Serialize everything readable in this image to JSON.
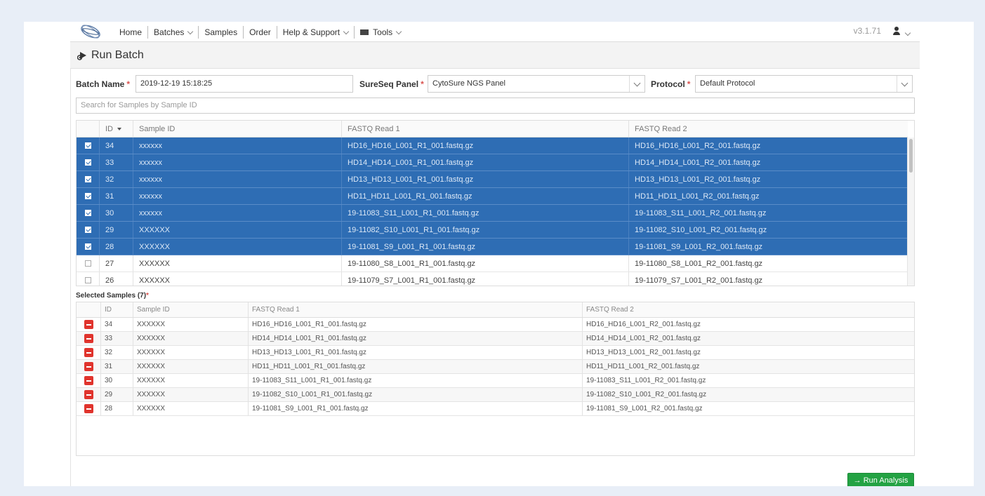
{
  "navbar": {
    "items": [
      {
        "label": "Home",
        "dropdown": false
      },
      {
        "label": "Batches",
        "dropdown": true
      },
      {
        "label": "Samples",
        "dropdown": false
      },
      {
        "label": "Order",
        "dropdown": false
      },
      {
        "label": "Help & Support",
        "dropdown": true
      },
      {
        "label": "Tools",
        "dropdown": true,
        "icon": "toolbox-icon"
      }
    ],
    "version": "v3.1.71"
  },
  "page": {
    "title": "Run Batch"
  },
  "form": {
    "batch_name_label": "Batch Name",
    "batch_name_value": "2019-12-19 15:18:25",
    "panel_label": "SureSeq Panel",
    "panel_value": "CytoSure NGS Panel",
    "protocol_label": "Protocol",
    "protocol_value": "Default Protocol",
    "required_mark": "*"
  },
  "search": {
    "placeholder": "Search for Samples by Sample ID"
  },
  "samples_table": {
    "columns": [
      "ID",
      "Sample ID",
      "FASTQ Read 1",
      "FASTQ Read 2"
    ],
    "rows": [
      {
        "id": "34",
        "sample_id": "xxxxxx",
        "read1": "HD16_HD16_L001_R1_001.fastq.gz",
        "read2": "HD16_HD16_L001_R2_001.fastq.gz",
        "selected": true
      },
      {
        "id": "33",
        "sample_id": "xxxxxx",
        "read1": "HD14_HD14_L001_R1_001.fastq.gz",
        "read2": "HD14_HD14_L001_R2_001.fastq.gz",
        "selected": true
      },
      {
        "id": "32",
        "sample_id": "xxxxxx",
        "read1": "HD13_HD13_L001_R1_001.fastq.gz",
        "read2": "HD13_HD13_L001_R2_001.fastq.gz",
        "selected": true
      },
      {
        "id": "31",
        "sample_id": "xxxxxx",
        "read1": "HD11_HD11_L001_R1_001.fastq.gz",
        "read2": "HD11_HD11_L001_R2_001.fastq.gz",
        "selected": true
      },
      {
        "id": "30",
        "sample_id": "xxxxxx",
        "read1": "19-11083_S11_L001_R1_001.fastq.gz",
        "read2": "19-11083_S11_L001_R2_001.fastq.gz",
        "selected": true
      },
      {
        "id": "29",
        "sample_id": "XXXXXX",
        "read1": "19-11082_S10_L001_R1_001.fastq.gz",
        "read2": "19-11082_S10_L001_R2_001.fastq.gz",
        "selected": true
      },
      {
        "id": "28",
        "sample_id": "XXXXXX",
        "read1": "19-11081_S9_L001_R1_001.fastq.gz",
        "read2": "19-11081_S9_L001_R2_001.fastq.gz",
        "selected": true
      },
      {
        "id": "27",
        "sample_id": "XXXXXX",
        "read1": "19-11080_S8_L001_R1_001.fastq.gz",
        "read2": "19-11080_S8_L001_R2_001.fastq.gz",
        "selected": false
      },
      {
        "id": "26",
        "sample_id": "XXXXXX",
        "read1": "19-11079_S7_L001_R1_001.fastq.gz",
        "read2": "19-11079_S7_L001_R2_001.fastq.gz",
        "selected": false
      }
    ]
  },
  "selected_samples": {
    "label": "Selected Samples (7)",
    "columns": [
      "ID",
      "Sample ID",
      "FASTQ Read 1",
      "FASTQ Read 2"
    ],
    "rows": [
      {
        "id": "34",
        "sample_id": "XXXXXX",
        "read1": "HD16_HD16_L001_R1_001.fastq.gz",
        "read2": "HD16_HD16_L001_R2_001.fastq.gz"
      },
      {
        "id": "33",
        "sample_id": "XXXXXX",
        "read1": "HD14_HD14_L001_R1_001.fastq.gz",
        "read2": "HD14_HD14_L001_R2_001.fastq.gz"
      },
      {
        "id": "32",
        "sample_id": "XXXXXX",
        "read1": "HD13_HD13_L001_R1_001.fastq.gz",
        "read2": "HD13_HD13_L001_R2_001.fastq.gz"
      },
      {
        "id": "31",
        "sample_id": "XXXXXX",
        "read1": "HD11_HD11_L001_R1_001.fastq.gz",
        "read2": "HD11_HD11_L001_R2_001.fastq.gz"
      },
      {
        "id": "30",
        "sample_id": "XXXXXX",
        "read1": "19-11083_S11_L001_R1_001.fastq.gz",
        "read2": "19-11083_S11_L001_R2_001.fastq.gz"
      },
      {
        "id": "29",
        "sample_id": "XXXXXX",
        "read1": "19-11082_S10_L001_R1_001.fastq.gz",
        "read2": "19-11082_S10_L001_R2_001.fastq.gz"
      },
      {
        "id": "28",
        "sample_id": "XXXXXX",
        "read1": "19-11081_S9_L001_R1_001.fastq.gz",
        "read2": "19-11081_S9_L001_R2_001.fastq.gz"
      }
    ]
  },
  "actions": {
    "run_label": "→ Run Analysis"
  },
  "colors": {
    "selection_blue": "#2e6db4",
    "run_green": "#23a243",
    "remove_red": "#e0342d",
    "required_red": "#d9534f"
  }
}
